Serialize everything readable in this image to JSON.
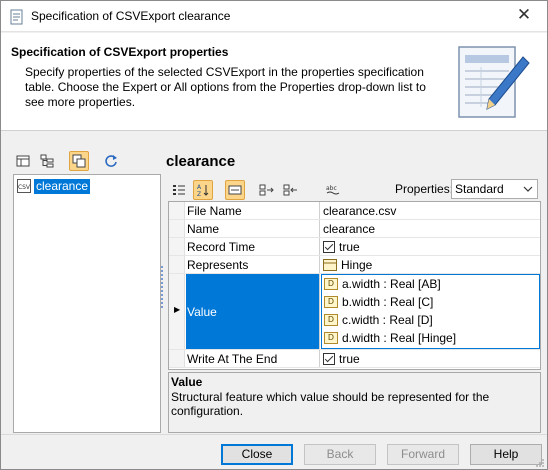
{
  "window": {
    "title": "Specification of CSVExport clearance",
    "close_glyph": "✕"
  },
  "header": {
    "title": "Specification of CSVExport properties",
    "description": "Specify properties of the selected CSVExport in the properties specification table. Choose the Expert or All options from the Properties drop-down list to see more properties.",
    "icon": "document-pencil-icon"
  },
  "left_toolbar": {
    "icons": [
      "list-view-icon",
      "tree-view-icon",
      "copy-icon",
      "refresh-icon"
    ]
  },
  "tree": {
    "items": [
      {
        "label": "clearance",
        "icon": "csv-icon",
        "icon_text": "CSV"
      }
    ]
  },
  "element_title": "clearance",
  "right_toolbar": {
    "icons": [
      "categorized-icon",
      "sort-az-icon",
      "table-icon",
      "expand-icon",
      "collapse-icon",
      "abc-icon"
    ],
    "properties_label": "Properties:",
    "properties_value": "Standard"
  },
  "properties": [
    {
      "name": "File Name",
      "value": "clearance.csv"
    },
    {
      "name": "Name",
      "value": "clearance"
    },
    {
      "name": "Record Time",
      "value": "true",
      "checked": true
    },
    {
      "name": "Represents",
      "value": "Hinge",
      "icon": "block-icon"
    },
    {
      "name": "Value",
      "values": [
        "a.width : Real [AB]",
        "b.width : Real [C]",
        "c.width : Real [D]",
        "d.width : Real [Hinge]"
      ],
      "selected": true
    },
    {
      "name": "Write At The End",
      "value": "true",
      "checked": true
    }
  ],
  "value_item_icon_text": "D",
  "description": {
    "title": "Value",
    "text": "Structural feature which value should be represented for the configuration."
  },
  "buttons": {
    "close": "Close",
    "back": "Back",
    "forward": "Forward",
    "help": "Help"
  },
  "colors": {
    "selection": "#0078d7",
    "active_tool": "#fbd68a"
  }
}
